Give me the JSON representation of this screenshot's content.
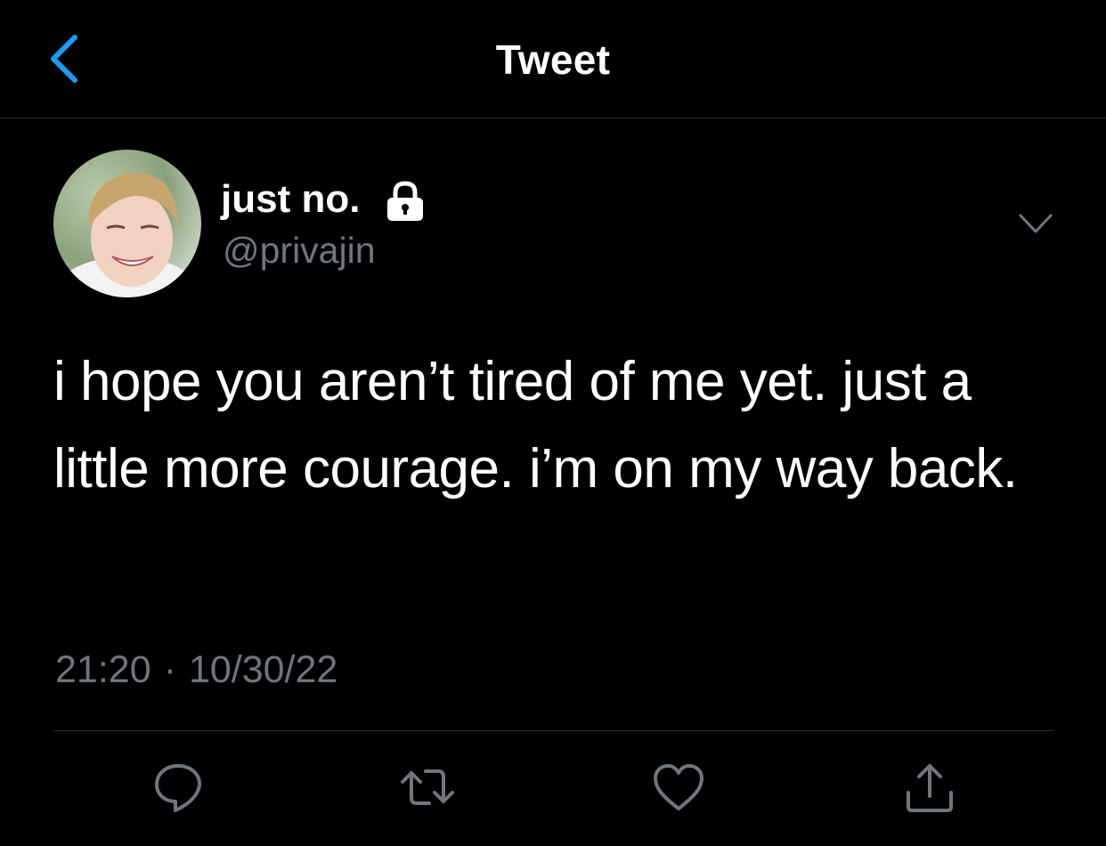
{
  "header": {
    "title": "Tweet",
    "back_icon": "chevron-left-icon",
    "accent": "#1d9bf0"
  },
  "author": {
    "display_name": "just no.",
    "handle": "@privajin",
    "protected_icon": "lock-icon",
    "avatar": "avatar"
  },
  "tweet": {
    "text": "i hope you aren’t tired of me yet. just a little more courage. i’m on my way back.",
    "time": "21:20",
    "separator": "·",
    "date": "10/30/22"
  },
  "actions": [
    {
      "name": "reply",
      "icon": "reply-icon"
    },
    {
      "name": "retweet",
      "icon": "retweet-icon"
    },
    {
      "name": "like",
      "icon": "heart-icon"
    },
    {
      "name": "share",
      "icon": "share-icon"
    }
  ],
  "colors": {
    "background": "#000000",
    "text": "#ffffff",
    "secondary": "#6e767d",
    "divider": "#2f3336",
    "accent": "#1d9bf0"
  }
}
